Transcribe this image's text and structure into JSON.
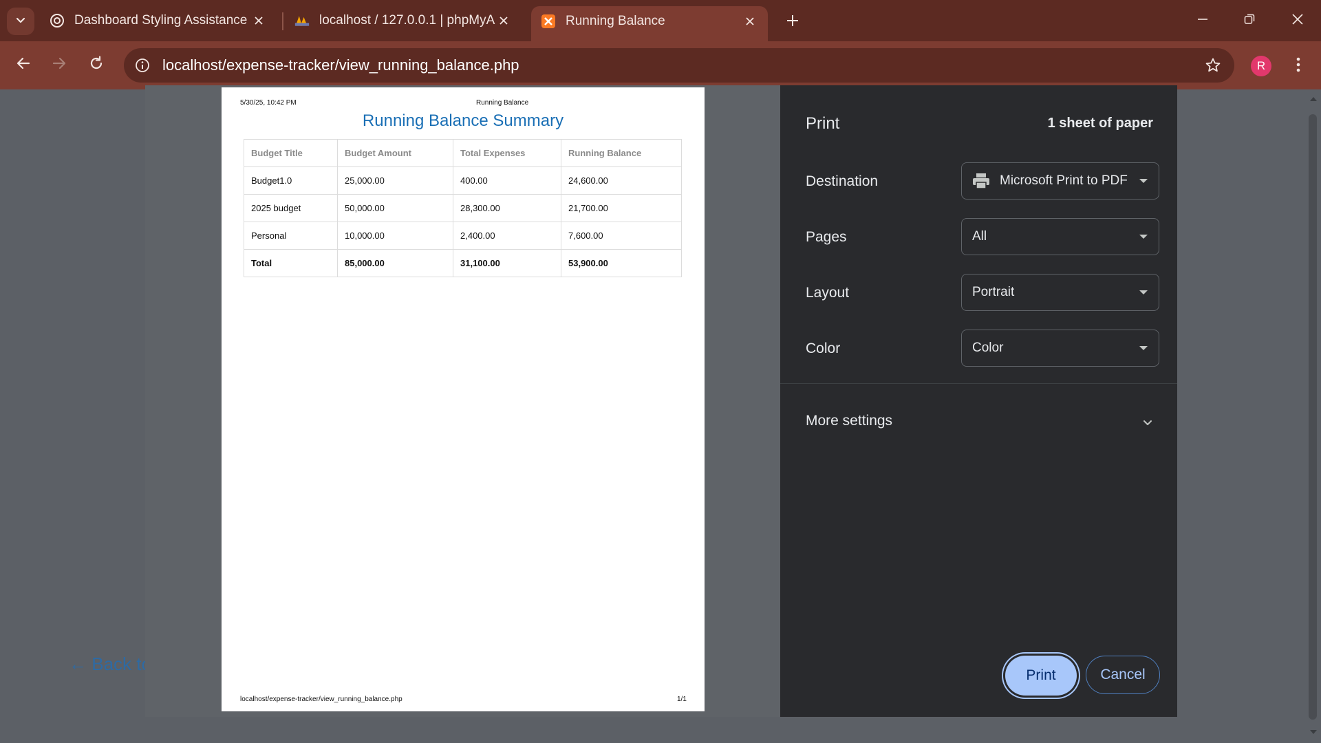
{
  "browser": {
    "tabs": [
      {
        "title": "Dashboard Styling Assistance",
        "icon": "openai-icon"
      },
      {
        "title": "localhost / 127.0.0.1 | phpMyAdmin",
        "icon": "phpmyadmin-icon"
      },
      {
        "title": "Running Balance",
        "icon": "xampp-icon"
      }
    ],
    "address": "localhost/expense-tracker/view_running_balance.php",
    "profile_initial": "R"
  },
  "page": {
    "back_link": "← Back to"
  },
  "preview": {
    "header_date": "5/30/25, 10:42 PM",
    "header_title": "Running Balance",
    "heading": "Running Balance Summary",
    "columns": [
      "Budget Title",
      "Budget Amount",
      "Total Expenses",
      "Running Balance"
    ],
    "rows": [
      [
        "Budget1.0",
        "25,000.00",
        "400.00",
        "24,600.00"
      ],
      [
        "2025 budget",
        "50,000.00",
        "28,300.00",
        "21,700.00"
      ],
      [
        "Personal",
        "10,000.00",
        "2,400.00",
        "7,600.00"
      ]
    ],
    "total": [
      "Total",
      "85,000.00",
      "31,100.00",
      "53,900.00"
    ],
    "footer_url": "localhost/expense-tracker/view_running_balance.php",
    "footer_page": "1/1"
  },
  "print": {
    "title": "Print",
    "sheets": "1 sheet of paper",
    "destination_label": "Destination",
    "destination_value": "Microsoft Print to PDF",
    "pages_label": "Pages",
    "pages_value": "All",
    "layout_label": "Layout",
    "layout_value": "Portrait",
    "color_label": "Color",
    "color_value": "Color",
    "more_settings": "More settings",
    "print_button": "Print",
    "cancel_button": "Cancel"
  }
}
